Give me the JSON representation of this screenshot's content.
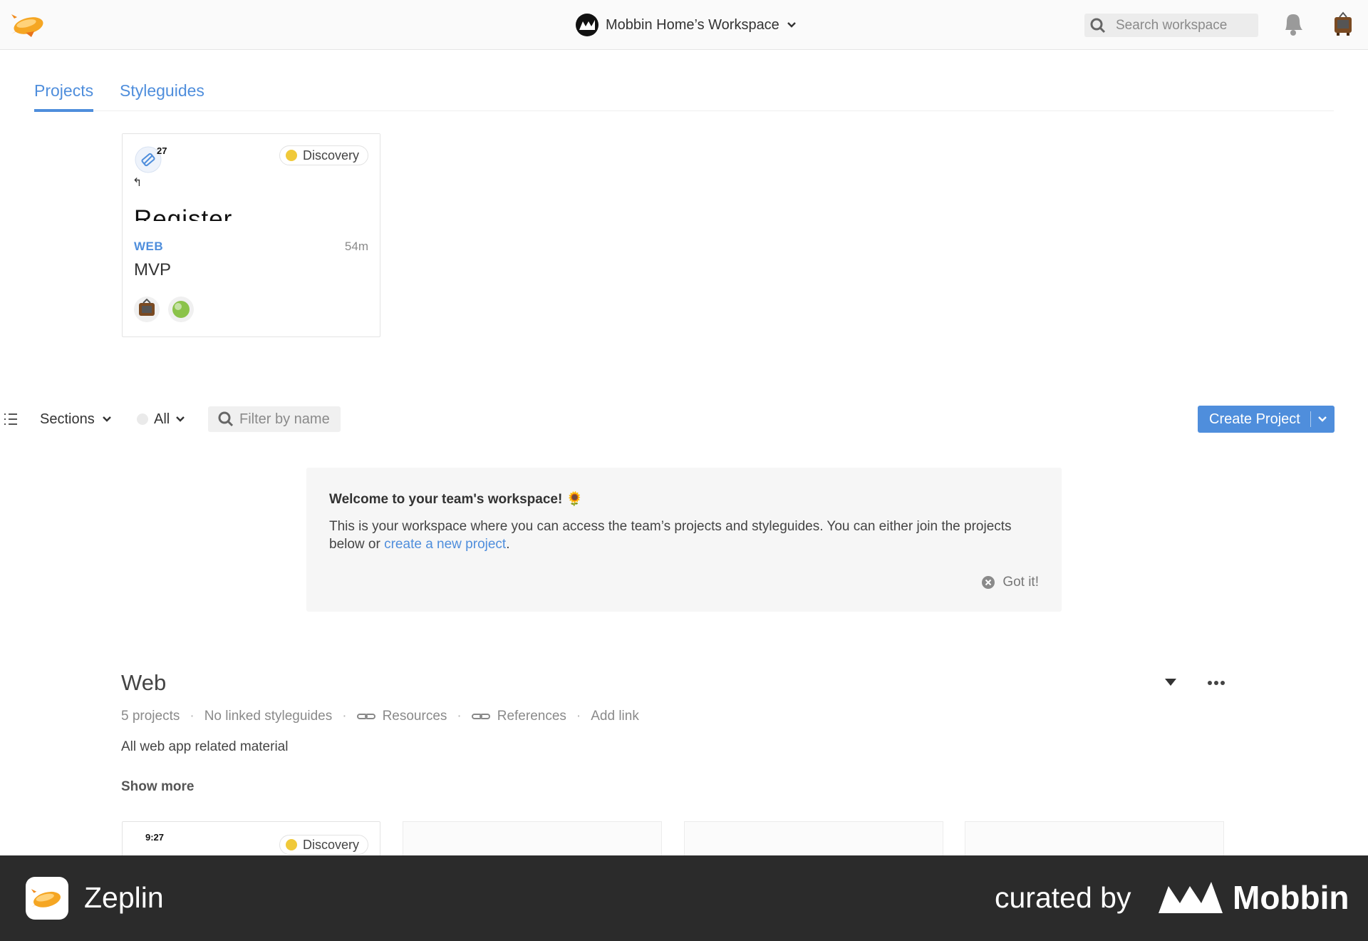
{
  "topbar": {
    "workspace_name": "Mobbin Home’s Workspace",
    "search_placeholder": "Search workspace"
  },
  "tabs": [
    {
      "label": "Projects",
      "active": true
    },
    {
      "label": "Styleguides",
      "active": false
    }
  ],
  "pinned_card": {
    "thumb_time": "27",
    "thumb_back": "↰",
    "thumb_title": "Register",
    "status": "Discovery",
    "status_color": "#f0c93a",
    "platform": "WEB",
    "time_ago": "54m",
    "name": "MVP",
    "members": [
      "tv-avatar-icon",
      "green-ball-avatar-icon"
    ]
  },
  "filterbar": {
    "sections_label": "Sections",
    "all_label": "All",
    "filter_placeholder": "Filter by name",
    "create_label": "Create Project"
  },
  "welcome": {
    "title": "Welcome to your team's workspace! 🌻",
    "text_before": "This is your workspace where you can access the team’s projects and styleguides. You can either join the projects below or ",
    "link": "create a new project",
    "text_after": ".",
    "dismiss": "Got it!"
  },
  "section": {
    "title": "Web",
    "projects_count": "5 projects",
    "styleguides": "No linked styleguides",
    "resources": "Resources",
    "references": "References",
    "add_link": "Add link",
    "description": "All web app related material",
    "show_more": "Show more"
  },
  "section_first_card": {
    "thumb_time": "9:27",
    "status": "Discovery"
  },
  "banner": {
    "app_name": "Zeplin",
    "curated": "curated by",
    "brand": "Mobbin"
  },
  "colors": {
    "accent": "#4f8edc",
    "banner_bg": "#2b2b2b",
    "discovery": "#f0c93a"
  }
}
